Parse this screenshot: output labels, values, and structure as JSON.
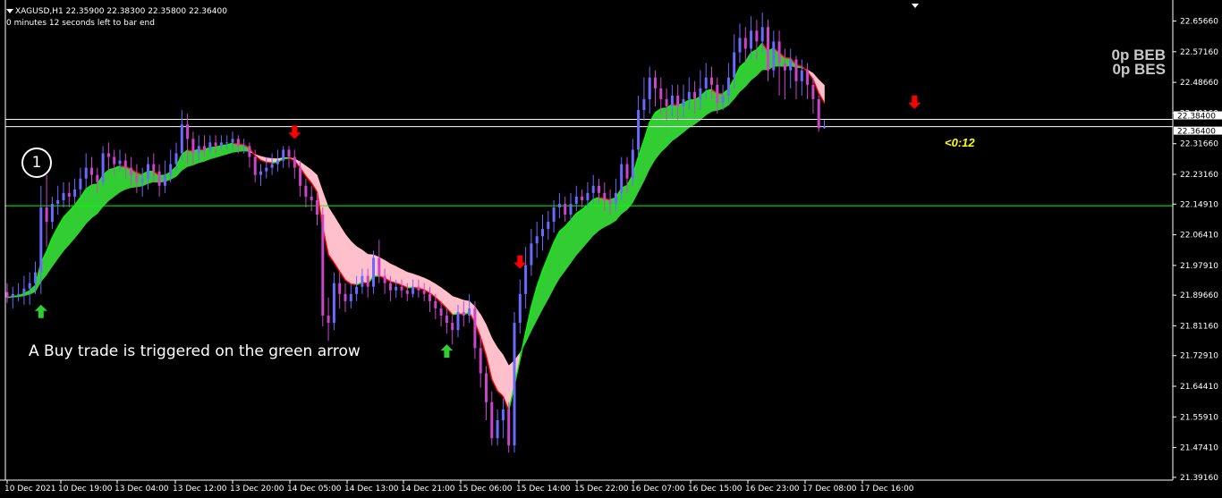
{
  "header": {
    "symbol_line": "XAGUSD,H1  22.35900 22.38300 22.35800 22.36400",
    "countdown_line": "0 minutes 12 seconds left to bar end"
  },
  "panel": {
    "beb_label": "0p BEB",
    "bes_label": "0p BES",
    "bar_timer": "<0:12"
  },
  "annotation": {
    "circle_number": "1",
    "caption": "A Buy trade is triggered on the green arrow"
  },
  "colors": {
    "background": "#000000",
    "axis": "#ffffff",
    "grid": "#ffffff",
    "bull_body": "#6a6aff",
    "bear_body": "#cc44cc",
    "band_up": "#32cd32",
    "band_down": "#ffc0cb",
    "signal_up": "#32cd32",
    "signal_down": "#ff0000",
    "trend_up": "#00ff00",
    "trend_down": "#ff0000",
    "support_line": "#00ff00",
    "price_line": "#ffffff",
    "timer_text": "#ffff00"
  },
  "chart_data": {
    "type": "candlestick",
    "symbol": "XAGUSD",
    "timeframe": "H1",
    "ylim": [
      21.3839,
      22.7026
    ],
    "y_ticks": [
      "22.65660",
      "22.57160",
      "22.48660",
      "22.40160",
      "22.31660",
      "22.23160",
      "22.14910",
      "22.06410",
      "21.97910",
      "21.89660",
      "21.81160",
      "21.72910",
      "21.64410",
      "21.55910",
      "21.47410",
      "21.39160"
    ],
    "x_ticks": [
      "10 Dec 2021",
      "10 Dec 19:00",
      "13 Dec 04:00",
      "13 Dec 12:00",
      "13 Dec 20:00",
      "14 Dec 05:00",
      "14 Dec 13:00",
      "14 Dec 21:00",
      "15 Dec 06:00",
      "15 Dec 14:00",
      "15 Dec 22:00",
      "16 Dec 07:00",
      "16 Dec 15:00",
      "16 Dec 23:00",
      "17 Dec 08:00",
      "17 Dec 16:00"
    ],
    "price_labels": [
      "22.38400",
      "22.36400"
    ],
    "horizontal_lines": [
      {
        "name": "ask",
        "value": 22.384
      },
      {
        "name": "bid",
        "value": 22.364
      },
      {
        "name": "support",
        "value": 22.1445
      }
    ],
    "candles": [
      [
        21.905,
        21.89,
        21.93,
        21.875
      ],
      [
        21.89,
        21.9,
        21.92,
        21.86
      ],
      [
        21.9,
        21.9,
        21.93,
        21.88
      ],
      [
        21.9,
        21.915,
        21.95,
        21.87
      ],
      [
        21.915,
        21.93,
        21.96,
        21.87
      ],
      [
        21.93,
        21.96,
        21.99,
        21.9
      ],
      [
        21.96,
        22.14,
        22.2,
        21.9
      ],
      [
        22.14,
        22.1,
        22.23,
        22.03
      ],
      [
        22.1,
        22.15,
        22.17,
        22.08
      ],
      [
        22.15,
        22.16,
        22.2,
        22.12
      ],
      [
        22.16,
        22.18,
        22.21,
        22.14
      ],
      [
        22.18,
        22.17,
        22.21,
        22.14
      ],
      [
        22.17,
        22.19,
        22.22,
        22.15
      ],
      [
        22.19,
        22.22,
        22.25,
        22.17
      ],
      [
        22.22,
        22.25,
        22.29,
        22.19
      ],
      [
        22.25,
        22.23,
        22.28,
        22.2
      ],
      [
        22.23,
        22.21,
        22.25,
        22.18
      ],
      [
        22.21,
        22.29,
        22.31,
        22.2
      ],
      [
        22.29,
        22.28,
        22.32,
        22.24
      ],
      [
        22.28,
        22.26,
        22.3,
        22.23
      ],
      [
        22.26,
        22.27,
        22.3,
        22.24
      ],
      [
        22.27,
        22.25,
        22.29,
        22.22
      ],
      [
        22.25,
        22.23,
        22.28,
        22.2
      ],
      [
        22.23,
        22.21,
        22.26,
        22.18
      ],
      [
        22.21,
        22.22,
        22.25,
        22.17
      ],
      [
        22.22,
        22.26,
        22.28,
        22.19
      ],
      [
        22.26,
        22.24,
        22.29,
        22.21
      ],
      [
        22.24,
        22.2,
        22.26,
        22.17
      ],
      [
        22.2,
        22.23,
        22.27,
        22.18
      ],
      [
        22.23,
        22.26,
        22.3,
        22.21
      ],
      [
        22.26,
        22.29,
        22.32,
        22.24
      ],
      [
        22.29,
        22.37,
        22.41,
        22.27
      ],
      [
        22.37,
        22.33,
        22.4,
        22.26
      ],
      [
        22.33,
        22.29,
        22.35,
        22.26
      ],
      [
        22.29,
        22.31,
        22.34,
        22.27
      ],
      [
        22.31,
        22.3,
        22.34,
        22.28
      ],
      [
        22.3,
        22.32,
        22.34,
        22.29
      ],
      [
        22.32,
        22.31,
        22.34,
        22.29
      ],
      [
        22.31,
        22.32,
        22.34,
        22.3
      ],
      [
        22.32,
        22.32,
        22.34,
        22.3
      ],
      [
        22.32,
        22.33,
        22.35,
        22.3
      ],
      [
        22.33,
        22.31,
        22.34,
        22.29
      ],
      [
        22.31,
        22.31,
        22.33,
        22.29
      ],
      [
        22.31,
        22.28,
        22.32,
        22.25
      ],
      [
        22.28,
        22.23,
        22.3,
        22.21
      ],
      [
        22.23,
        22.24,
        22.26,
        22.2
      ],
      [
        22.24,
        22.25,
        22.28,
        22.22
      ],
      [
        22.25,
        22.26,
        22.29,
        22.23
      ],
      [
        22.26,
        22.27,
        22.3,
        22.24
      ],
      [
        22.27,
        22.3,
        22.31,
        22.25
      ],
      [
        22.3,
        22.28,
        22.31,
        22.25
      ],
      [
        22.28,
        22.25,
        22.3,
        22.22
      ],
      [
        22.25,
        22.2,
        22.27,
        22.17
      ],
      [
        22.2,
        22.17,
        22.22,
        22.14
      ],
      [
        22.17,
        22.16,
        22.2,
        22.13
      ],
      [
        22.16,
        22.12,
        22.18,
        22.09
      ],
      [
        22.12,
        21.84,
        22.14,
        21.81
      ],
      [
        21.84,
        21.82,
        21.89,
        21.77
      ],
      [
        21.82,
        21.93,
        21.96,
        21.8
      ],
      [
        21.93,
        21.9,
        21.96,
        21.86
      ],
      [
        21.9,
        21.88,
        21.93,
        21.85
      ],
      [
        21.88,
        21.9,
        21.93,
        21.86
      ],
      [
        21.9,
        21.92,
        21.95,
        21.88
      ],
      [
        21.92,
        21.95,
        21.97,
        21.9
      ],
      [
        21.95,
        21.92,
        21.97,
        21.89
      ],
      [
        21.92,
        22.0,
        22.02,
        21.9
      ],
      [
        22.0,
        21.95,
        22.05,
        21.93
      ],
      [
        21.95,
        21.93,
        21.97,
        21.9
      ],
      [
        21.93,
        21.91,
        21.95,
        21.88
      ],
      [
        21.91,
        21.92,
        21.94,
        21.89
      ],
      [
        21.92,
        21.91,
        21.94,
        21.89
      ],
      [
        21.91,
        21.9,
        21.93,
        21.88
      ],
      [
        21.9,
        21.92,
        21.94,
        21.89
      ],
      [
        21.92,
        21.91,
        21.94,
        21.89
      ],
      [
        21.91,
        21.9,
        21.93,
        21.88
      ],
      [
        21.9,
        21.88,
        21.92,
        21.85
      ],
      [
        21.88,
        21.86,
        21.9,
        21.83
      ],
      [
        21.86,
        21.84,
        21.88,
        21.81
      ],
      [
        21.84,
        21.82,
        21.86,
        21.79
      ],
      [
        21.82,
        21.8,
        21.84,
        21.76
      ],
      [
        21.8,
        21.85,
        21.87,
        21.78
      ],
      [
        21.85,
        21.84,
        21.88,
        21.81
      ],
      [
        21.84,
        21.86,
        21.9,
        21.82
      ],
      [
        21.86,
        21.75,
        21.88,
        21.72
      ],
      [
        21.75,
        21.68,
        21.78,
        21.64
      ],
      [
        21.68,
        21.6,
        21.7,
        21.55
      ],
      [
        21.6,
        21.5,
        21.63,
        21.48
      ],
      [
        21.5,
        21.55,
        21.58,
        21.48
      ],
      [
        21.55,
        21.58,
        21.61,
        21.5
      ],
      [
        21.58,
        21.48,
        21.6,
        21.46
      ],
      [
        21.48,
        21.82,
        21.85,
        21.46
      ],
      [
        21.82,
        21.9,
        21.94,
        21.79
      ],
      [
        21.9,
        21.98,
        22.03,
        21.86
      ],
      [
        21.98,
        22.04,
        22.08,
        21.95
      ],
      [
        22.04,
        22.06,
        22.1,
        22.0
      ],
      [
        22.06,
        22.08,
        22.12,
        22.02
      ],
      [
        22.08,
        22.1,
        22.13,
        22.05
      ],
      [
        22.1,
        22.14,
        22.16,
        22.07
      ],
      [
        22.14,
        22.15,
        22.18,
        22.11
      ],
      [
        22.15,
        22.12,
        22.17,
        22.1
      ],
      [
        22.12,
        22.15,
        22.18,
        22.1
      ],
      [
        22.15,
        22.17,
        22.2,
        22.13
      ],
      [
        22.17,
        22.16,
        22.19,
        22.14
      ],
      [
        22.16,
        22.18,
        22.21,
        22.14
      ],
      [
        22.18,
        22.2,
        22.23,
        22.15
      ],
      [
        22.2,
        22.18,
        22.22,
        22.15
      ],
      [
        22.18,
        22.16,
        22.21,
        22.13
      ],
      [
        22.16,
        22.15,
        22.19,
        22.12
      ],
      [
        22.15,
        22.18,
        22.22,
        22.13
      ],
      [
        22.18,
        22.26,
        22.28,
        22.16
      ],
      [
        22.26,
        22.22,
        22.28,
        22.18
      ],
      [
        22.22,
        22.3,
        22.33,
        22.2
      ],
      [
        22.3,
        22.41,
        22.45,
        22.28
      ],
      [
        22.41,
        22.44,
        22.5,
        22.38
      ],
      [
        22.44,
        22.5,
        22.53,
        22.4
      ],
      [
        22.5,
        22.47,
        22.52,
        22.42
      ],
      [
        22.47,
        22.44,
        22.5,
        22.4
      ],
      [
        22.44,
        22.42,
        22.47,
        22.38
      ],
      [
        22.42,
        22.45,
        22.48,
        22.39
      ],
      [
        22.45,
        22.42,
        22.48,
        22.38
      ],
      [
        22.42,
        22.44,
        22.48,
        22.39
      ],
      [
        22.44,
        22.46,
        22.5,
        22.41
      ],
      [
        22.46,
        22.44,
        22.49,
        22.4
      ],
      [
        22.44,
        22.47,
        22.52,
        22.41
      ],
      [
        22.47,
        22.5,
        22.54,
        22.44
      ],
      [
        22.5,
        22.48,
        22.53,
        22.44
      ],
      [
        22.48,
        22.43,
        22.5,
        22.4
      ],
      [
        22.43,
        22.45,
        22.48,
        22.41
      ],
      [
        22.45,
        22.5,
        22.54,
        22.43
      ],
      [
        22.5,
        22.57,
        22.62,
        22.47
      ],
      [
        22.57,
        22.61,
        22.65,
        22.54
      ],
      [
        22.61,
        22.58,
        22.64,
        22.54
      ],
      [
        22.58,
        22.63,
        22.67,
        22.55
      ],
      [
        22.63,
        22.6,
        22.66,
        22.55
      ],
      [
        22.6,
        22.64,
        22.68,
        22.57
      ],
      [
        22.64,
        22.52,
        22.66,
        22.49
      ],
      [
        22.52,
        22.6,
        22.63,
        22.5
      ],
      [
        22.6,
        22.54,
        22.63,
        22.45
      ],
      [
        22.54,
        22.52,
        22.58,
        22.44
      ],
      [
        22.52,
        22.55,
        22.58,
        22.47
      ],
      [
        22.55,
        22.49,
        22.56,
        22.44
      ],
      [
        22.49,
        22.52,
        22.55,
        22.45
      ],
      [
        22.52,
        22.48,
        22.54,
        22.44
      ],
      [
        22.48,
        22.44,
        22.5,
        22.4
      ],
      [
        22.44,
        22.36,
        22.45,
        22.35
      ],
      [
        22.36,
        22.364,
        22.383,
        22.358
      ]
    ],
    "signals": [
      {
        "type": "buy",
        "bar": 6
      },
      {
        "type": "sell",
        "bar": 51
      },
      {
        "type": "buy",
        "bar": 78
      },
      {
        "type": "sell",
        "bar": 91
      },
      {
        "type": "buy",
        "bar": 104
      },
      {
        "type": "sell",
        "bar": 161
      }
    ]
  }
}
